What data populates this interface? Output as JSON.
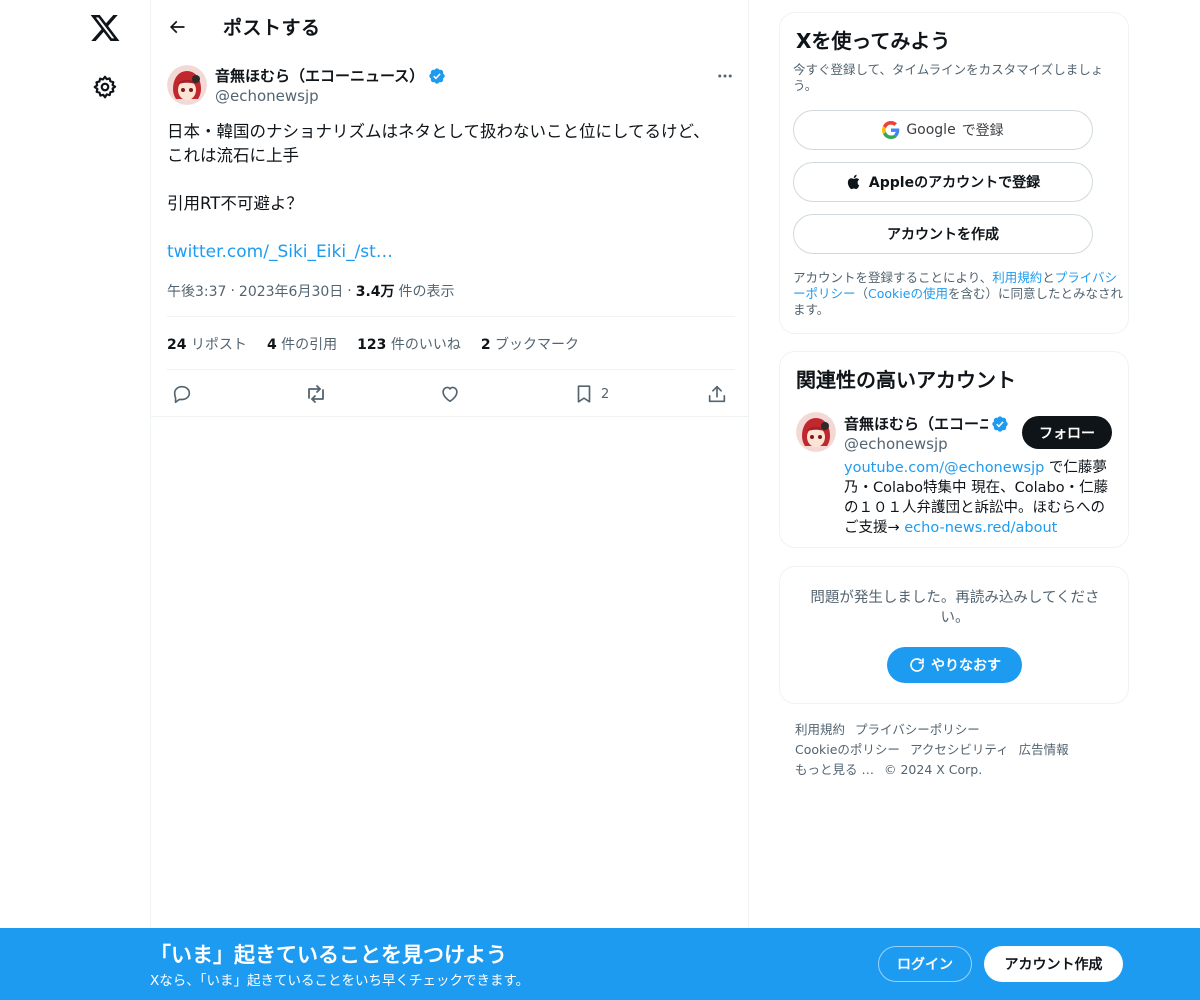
{
  "colors": {
    "accent": "#1d9bf0",
    "text": "#0f1419",
    "secondary": "#536471",
    "border": "#eff3f4"
  },
  "nav": {
    "logo_icon": "x-logo-icon",
    "settings_icon": "gear-icon"
  },
  "header": {
    "title": "ポストする",
    "back_icon": "back-arrow-icon"
  },
  "post": {
    "author_name": "音無ほむら（エコーニュース）",
    "author_handle": "@echonewsjp",
    "verified_icon": "verified-badge-icon",
    "text_line1": "日本・韓国のナショナリズムはネタとして扱わないこと位にしてるけど、",
    "text_line2": "これは流石に上手",
    "text_line3": "引用RT不可避よ？",
    "link": "twitter.com/_Siki_Eiki_/st…",
    "time": "午後3:37",
    "date": "2023年6月30日",
    "views_count": "3.4万",
    "views_label": "件の表示",
    "stats": {
      "reposts_count": "24",
      "reposts_label": "リポスト",
      "quotes_count": "4",
      "quotes_label": "件の引用",
      "likes_count": "123",
      "likes_label": "件のいいね",
      "bookmarks_count": "2",
      "bookmarks_label": "ブックマーク"
    },
    "actions": {
      "bookmark_count": "2"
    }
  },
  "signup": {
    "title": "Xを使ってみよう",
    "subtitle": "今すぐ登録して、タイムラインをカスタマイズしましょう。",
    "google_label_brand": "Google",
    "google_label_rest": "で登録",
    "apple_label": "Appleのアカウントで登録",
    "create_label": "アカウントを作成",
    "terms_prefix": "アカウントを登録することにより、",
    "terms_link": "利用規約",
    "terms_and": "と",
    "privacy_link": "プライバシーポリシー",
    "terms_mid": "（",
    "cookie_link": "Cookieの使用",
    "terms_suffix": "を含む）に同意したとみなされます。"
  },
  "related": {
    "title": "関連性の高いアカウント",
    "name": "音無ほむら（エコーニュース）",
    "handle": "@echonewsjp",
    "follow_label": "フォロー",
    "bio_link1": "youtube.com/@echonewsjp",
    "bio_text": " で仁藤夢乃・Colabo特集中 現在、Colabo・仁藤の１０１人弁護団と訴訟中。ほむらへのご支援→ ",
    "bio_link2": "echo-news.red/about"
  },
  "error": {
    "message": "問題が発生しました。再読み込みしてください。",
    "retry_label": "やりなおす"
  },
  "footer": {
    "terms": "利用規約",
    "privacy": "プライバシーポリシー",
    "cookie": "Cookieのポリシー",
    "accessibility": "アクセシビリティ",
    "ads": "広告情報",
    "more": "もっと見る …",
    "copyright": "© 2024 X Corp."
  },
  "bottom_bar": {
    "title": "「いま」起きていることを見つけよう",
    "subtitle": "Xなら、「いま」起きていることをいち早くチェックできます。",
    "login_label": "ログイン",
    "signup_label": "アカウント作成"
  }
}
